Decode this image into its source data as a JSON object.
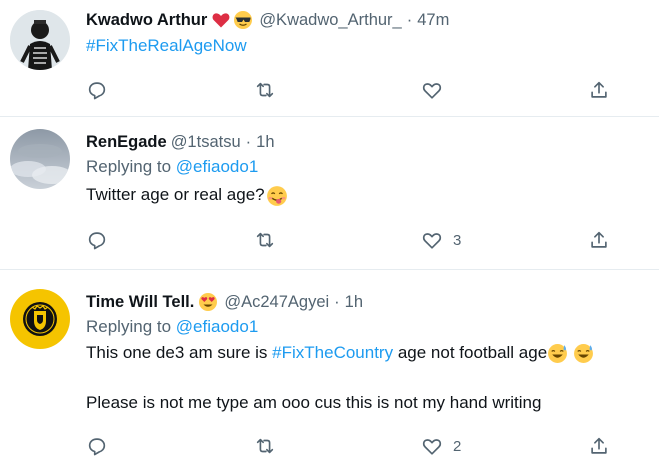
{
  "tweets": [
    {
      "name": "Kwadwo Arthur",
      "handle": "@Kwadwo_Arthur_",
      "separator": "·",
      "time": "47m",
      "name_emojis": [
        "red-heart-emoji",
        "sunglasses-face-emoji"
      ],
      "body": "#FixTheRealAgeNow",
      "like_count": "",
      "avatar": "skeleton-avatar-icon"
    },
    {
      "name": "RenEgade",
      "handle": "@1tsatsu",
      "separator": "·",
      "time": "1h",
      "replying_prefix": "Replying to",
      "replying_to": "@efiaodo1",
      "body": "Twitter age or real age?",
      "body_emoji": "tongue-wink-face-emoji",
      "like_count": "3",
      "avatar": "cloudy-sky-avatar-icon"
    },
    {
      "name": "Time Will Tell.",
      "handle": "@Ac247Agyei",
      "separator": "·",
      "time": "1h",
      "name_emojis": [
        "heart-eyes-face-emoji"
      ],
      "replying_prefix": "Replying to",
      "replying_to": "@efiaodo1",
      "body_prefix": "This one de3 am sure is",
      "body_hashtag": "#FixTheCountry",
      "body_suffix": "age not football age",
      "body_emojis": [
        "sweat-smile-face-emoji",
        "sweat-smile-face-emoji"
      ],
      "body_second": "Please is not me type am ooo cus this is not my hand writing",
      "like_count": "2",
      "avatar": "club-crest-avatar-icon"
    }
  ],
  "colors": {
    "accent": "#1d9bf0",
    "secondary_text": "#536471",
    "divider": "#e6ecf0"
  }
}
